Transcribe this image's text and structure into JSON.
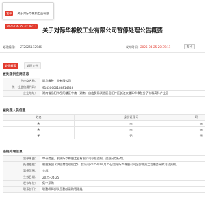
{
  "toast": {
    "tag": "发布",
    "title": "关于对际华橡胶工业有限",
    "time": "2025-04-25 20:36:11"
  },
  "page_title": "关于对际华橡胶工业有限公司暂停处理公告概要",
  "meta": {
    "no_label": "处理编号：",
    "no_value": "ZT2025112946",
    "time_label": "发布时间：",
    "time_value": "2025-04-25 20:39:11",
    "print_label": "打印"
  },
  "tabs": [
    {
      "label": "处理概要"
    },
    {
      "label": "处理文件"
    }
  ],
  "supplier": {
    "section_title": "被处理供应商信息",
    "rows": [
      {
        "k": "供应商名称：",
        "v": "际华橡胶工业有限公司"
      },
      {
        "k": "统一社会信用代码：",
        "v": "91430600186814346"
      },
      {
        "k": "企业地址：",
        "v": "湖南省岳阳市岳阳楼区中南（湖南）自由贸易试验区岳阳片区长江大道际华橡胶分子材料高科产业园"
      }
    ]
  },
  "persons": {
    "section_title": "被处理人员信息",
    "headers": [
      "姓名",
      "身份证号码",
      "职"
    ],
    "rows": [
      [
        "无",
        "无",
        "无"
      ],
      [
        "无",
        "无",
        "无"
      ],
      [
        "无",
        "无",
        "无"
      ]
    ]
  },
  "rule": {
    "section_title": "违规处理信息",
    "rows": [
      {
        "k": "暂停事由：",
        "v": "审计提出，发现际华橡胶工业有限公司存在违规，违规分包行为。"
      },
      {
        "k": "处理依据：",
        "v": "根据集团《供应商管理规定》，我公司2025年04月25日暂停际华橡胶公司全部物资工程服务采购活动资格。"
      },
      {
        "k": "暂停范围：",
        "v": "全部"
      },
      {
        "k": "生效日期：",
        "v": "2025-04-25"
      },
      {
        "k": "发布单位：",
        "v": "集中采购"
      },
      {
        "k": "联系部门：",
        "v": "联勤保障部队后勤部采购管理处"
      }
    ]
  }
}
